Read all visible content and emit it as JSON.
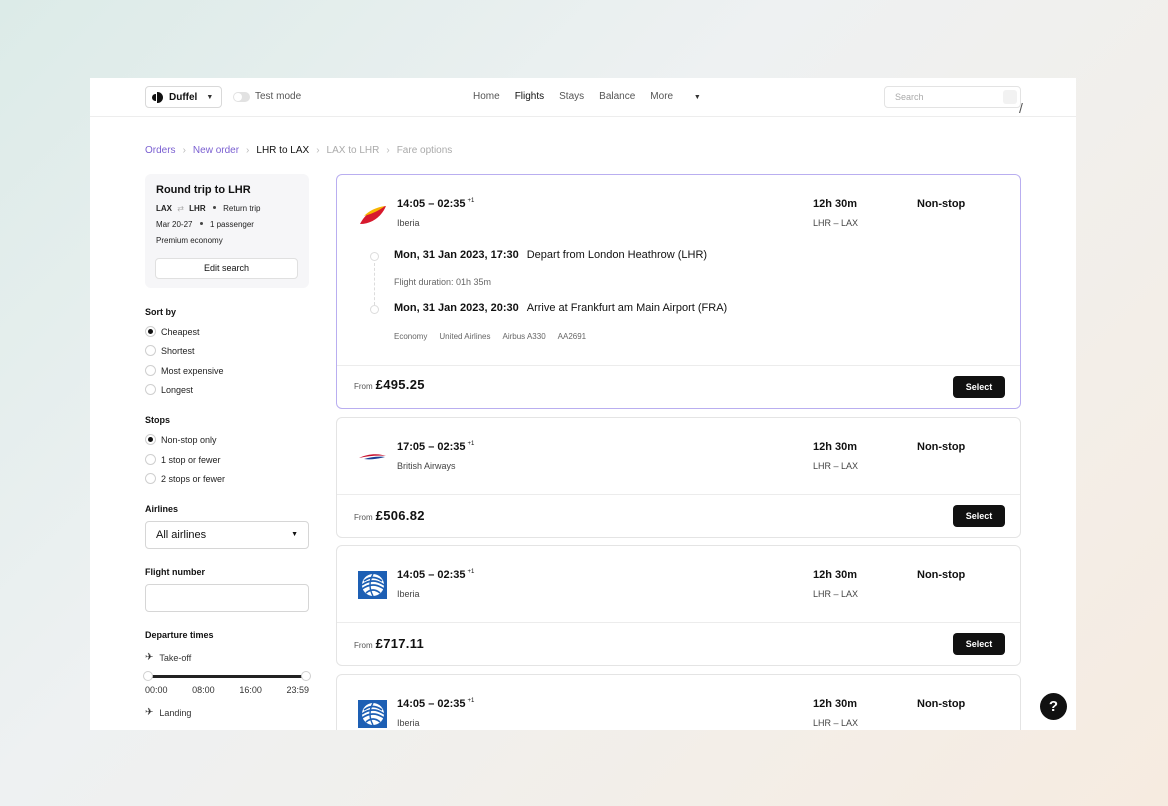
{
  "header": {
    "org_name": "Duffel",
    "test_mode_label": "Test mode",
    "nav": [
      "Home",
      "Flights",
      "Stays",
      "Balance",
      "More"
    ],
    "active_nav": "Flights",
    "search_placeholder": "Search"
  },
  "breadcrumbs": {
    "orders": "Orders",
    "new_order": "New order",
    "current": "LHR to LAX",
    "next": "LAX to LHR",
    "fare": "Fare options"
  },
  "trip": {
    "title": "Round trip to LHR",
    "origin": "LAX",
    "destination": "LHR",
    "trip_type": "Return trip",
    "dates": "Mar 20-27",
    "passengers": "1 passenger",
    "cabin": "Premium economy",
    "edit_label": "Edit search"
  },
  "filters": {
    "sort_title": "Sort by",
    "sort_options": [
      "Cheapest",
      "Shortest",
      "Most expensive",
      "Longest"
    ],
    "sort_selected": "Cheapest",
    "stops_title": "Stops",
    "stops_options": [
      "Non-stop only",
      "1 stop or fewer",
      "2 stops or fewer"
    ],
    "stops_selected": "Non-stop only",
    "airlines_title": "Airlines",
    "airlines_value": "All airlines",
    "flight_number_title": "Flight number",
    "flight_number_value": "",
    "departure_title": "Departure times",
    "takeoff_label": "Take-off",
    "landing_label": "Landing",
    "ticks": [
      "00:00",
      "08:00",
      "16:00",
      "23:59"
    ]
  },
  "offers": [
    {
      "times": "14:05 – 02:35",
      "day_offset": "+1",
      "airline": "Iberia",
      "duration": "12h 30m",
      "route": "LHR – LAX",
      "stops": "Non-stop",
      "from_label": "From",
      "price": "£495.25",
      "select_label": "Select",
      "logo": "iberia-logo",
      "details": {
        "depart_time": "Mon, 31 Jan 2023, 17:30",
        "depart_text": "Depart from London Heathrow (LHR)",
        "flight_duration": "Flight duration:  01h 35m",
        "arrive_time": "Mon, 31 Jan 2023, 20:30",
        "arrive_text": "Arrive at Frankfurt am Main Airport (FRA)",
        "meta": [
          "Economy",
          "United Airlines",
          "Airbus A330",
          "AA2691"
        ]
      }
    },
    {
      "times": "17:05 – 02:35",
      "day_offset": "+1",
      "airline": "British Airways",
      "duration": "12h 30m",
      "route": "LHR – LAX",
      "stops": "Non-stop",
      "from_label": "From",
      "price": "£506.82",
      "select_label": "Select",
      "logo": "british-airways-logo"
    },
    {
      "times": "14:05 – 02:35",
      "day_offset": "+1",
      "airline": "Iberia",
      "duration": "12h 30m",
      "route": "LHR – LAX",
      "stops": "Non-stop",
      "from_label": "From",
      "price": "£717.11",
      "select_label": "Select",
      "logo": "united-globe-logo"
    },
    {
      "times": "14:05 – 02:35",
      "day_offset": "+1",
      "airline": "Iberia",
      "duration": "12h 30m",
      "route": "LHR – LAX",
      "stops": "Non-stop",
      "logo": "united-globe-logo"
    }
  ],
  "help_label": "?",
  "colors": {
    "accent": "#7a5fd1",
    "button": "#111111",
    "selected_border": "#b9aef0"
  }
}
